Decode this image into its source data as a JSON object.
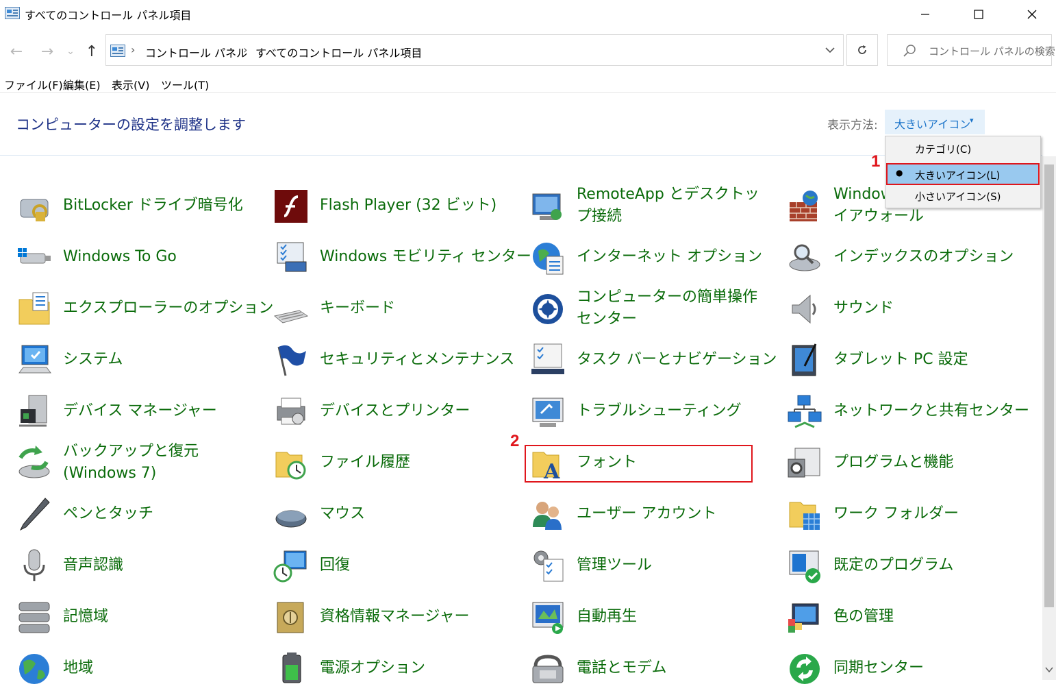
{
  "window": {
    "title": "すべてのコントロール パネル項目",
    "minimize": "—",
    "maximize": "☐",
    "close": "✕"
  },
  "nav": {
    "back": "←",
    "forward": "→",
    "recent": "⌄",
    "up": "↑"
  },
  "address": {
    "breadcrumbs": [
      "コントロール パネル",
      "すべてのコントロール パネル項目"
    ],
    "separator": "›"
  },
  "search": {
    "placeholder": "コントロール パネルの検索"
  },
  "menu": [
    "ファイル(F)",
    "編集(E)",
    "表示(V)",
    "ツール(T)"
  ],
  "header": {
    "title": "コンピューターの設定を調整します",
    "view_label": "表示方法:",
    "view_value": "大きいアイコン",
    "view_caret": "▾"
  },
  "view_menu": {
    "options": [
      "カテゴリ(C)",
      "大きいアイコン(L)",
      "小さいアイコン(S)"
    ],
    "selected": "大きいアイコン(L)",
    "bullet": "●"
  },
  "annotations": {
    "marker1": "1",
    "marker2": "2"
  },
  "items": [
    {
      "label": "BitLocker ドライブ暗号化",
      "icon": "bitlocker-icon"
    },
    {
      "label": "Flash Player (32 ビット)",
      "icon": "flash-icon"
    },
    {
      "label": "RemoteApp とデスクトップ接続",
      "icon": "remoteapp-icon"
    },
    {
      "label": "Windows ファイアウォール",
      "icon": "firewall-icon"
    },
    {
      "label": "Windows To Go",
      "icon": "usb-drive-icon"
    },
    {
      "label": "Windows モビリティ センター",
      "icon": "mobility-icon"
    },
    {
      "label": "インターネット オプション",
      "icon": "internet-icon"
    },
    {
      "label": "インデックスのオプション",
      "icon": "indexing-icon"
    },
    {
      "label": "エクスプローラーのオプション",
      "icon": "explorer-options-icon"
    },
    {
      "label": "キーボード",
      "icon": "keyboard-icon"
    },
    {
      "label": "コンピューターの簡単操作センター",
      "icon": "ease-of-access-icon"
    },
    {
      "label": "サウンド",
      "icon": "sound-icon"
    },
    {
      "label": "システム",
      "icon": "system-icon"
    },
    {
      "label": "セキュリティとメンテナンス",
      "icon": "security-flag-icon"
    },
    {
      "label": "タスク バーとナビゲーション",
      "icon": "taskbar-icon"
    },
    {
      "label": "タブレット PC 設定",
      "icon": "tablet-icon"
    },
    {
      "label": "デバイス マネージャー",
      "icon": "device-manager-icon"
    },
    {
      "label": "デバイスとプリンター",
      "icon": "printer-icon"
    },
    {
      "label": "トラブルシューティング",
      "icon": "troubleshoot-icon"
    },
    {
      "label": "ネットワークと共有センター",
      "icon": "network-icon"
    },
    {
      "label": "バックアップと復元 (Windows 7)",
      "icon": "backup-icon"
    },
    {
      "label": "ファイル履歴",
      "icon": "file-history-icon"
    },
    {
      "label": "フォント",
      "icon": "fonts-icon"
    },
    {
      "label": "プログラムと機能",
      "icon": "programs-icon"
    },
    {
      "label": "ペンとタッチ",
      "icon": "pen-icon"
    },
    {
      "label": "マウス",
      "icon": "mouse-icon"
    },
    {
      "label": "ユーザー アカウント",
      "icon": "user-accounts-icon"
    },
    {
      "label": "ワーク フォルダー",
      "icon": "work-folders-icon"
    },
    {
      "label": "音声認識",
      "icon": "microphone-icon"
    },
    {
      "label": "回復",
      "icon": "recovery-icon"
    },
    {
      "label": "管理ツール",
      "icon": "admin-tools-icon"
    },
    {
      "label": "既定のプログラム",
      "icon": "default-programs-icon"
    },
    {
      "label": "記憶域",
      "icon": "storage-icon"
    },
    {
      "label": "資格情報マネージャー",
      "icon": "credential-vault-icon"
    },
    {
      "label": "自動再生",
      "icon": "autoplay-icon"
    },
    {
      "label": "色の管理",
      "icon": "color-management-icon"
    },
    {
      "label": "地域",
      "icon": "region-globe-icon"
    },
    {
      "label": "電源オプション",
      "icon": "power-icon"
    },
    {
      "label": "電話とモデム",
      "icon": "phone-icon"
    },
    {
      "label": "同期センター",
      "icon": "sync-icon"
    }
  ],
  "colors": {
    "link_green": "#0a6b0a",
    "title_blue": "#1e3287",
    "annotation_red": "#e0161c",
    "selected_bg": "#99c9ef"
  }
}
